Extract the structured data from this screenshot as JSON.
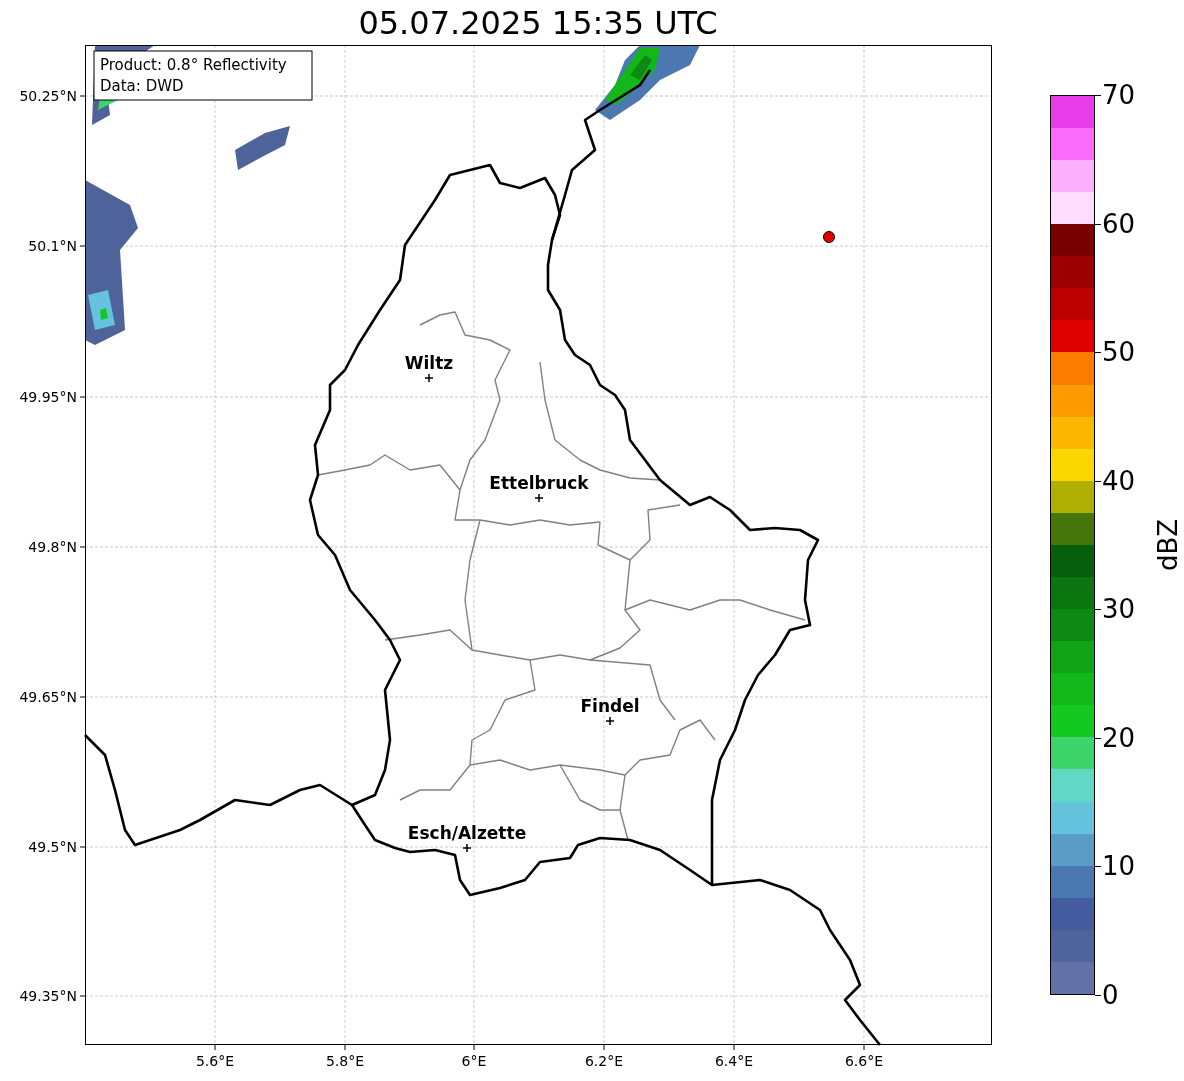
{
  "title": "05.07.2025 15:35 UTC",
  "info_box": [
    "Product: 0.8° Reflectivity",
    "Data: DWD"
  ],
  "x_ticks": [
    "5.6°E",
    "5.8°E",
    "6°E",
    "6.2°E",
    "6.4°E",
    "6.6°E"
  ],
  "y_ticks": [
    "50.25°N",
    "50.1°N",
    "49.95°N",
    "49.8°N",
    "49.65°N",
    "49.5°N",
    "49.35°N"
  ],
  "cities": [
    {
      "name": "Wiltz"
    },
    {
      "name": "Ettelbruck"
    },
    {
      "name": "Findel"
    },
    {
      "name": "Esch/Alzette"
    }
  ],
  "colorbar": {
    "label": "dBZ",
    "ticks": [
      "70",
      "60",
      "50",
      "40",
      "30",
      "20",
      "10",
      "0"
    ],
    "segments": [
      {
        "color": "#6271a6"
      },
      {
        "color": "#4e6399"
      },
      {
        "color": "#435c9e"
      },
      {
        "color": "#4b78b0"
      },
      {
        "color": "#5b9cc6"
      },
      {
        "color": "#66c3de"
      },
      {
        "color": "#61d8c6"
      },
      {
        "color": "#3ed46c"
      },
      {
        "color": "#13c81f"
      },
      {
        "color": "#12b81a"
      },
      {
        "color": "#10a316"
      },
      {
        "color": "#0e8a14"
      },
      {
        "color": "#0b7510"
      },
      {
        "color": "#075e0d"
      },
      {
        "color": "#46760a"
      },
      {
        "color": "#b0b004"
      },
      {
        "color": "#fcd600"
      },
      {
        "color": "#fcb800"
      },
      {
        "color": "#fc9a00"
      },
      {
        "color": "#fc7c00"
      },
      {
        "color": "#e00000"
      },
      {
        "color": "#bc0000"
      },
      {
        "color": "#9c0000"
      },
      {
        "color": "#780000"
      },
      {
        "color": "#fddcfd"
      },
      {
        "color": "#fcb0fc"
      },
      {
        "color": "#fc6cfc"
      },
      {
        "color": "#e83ce8"
      }
    ]
  }
}
